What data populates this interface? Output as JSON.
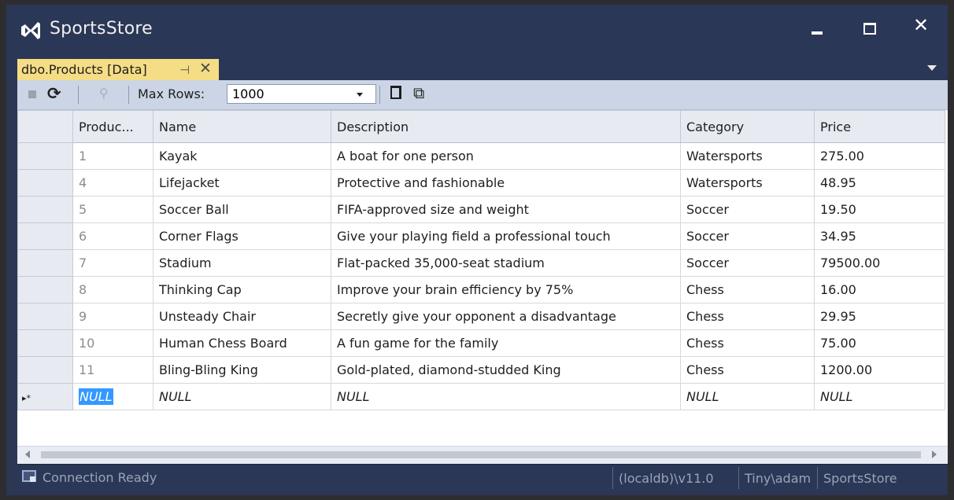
{
  "window": {
    "title": "SportsStore",
    "minimize_glyph": "minimize",
    "maximize_glyph": "maximize",
    "close_glyph": "✕"
  },
  "tab": {
    "label": "dbo.Products [Data]",
    "pin_glyph": "⊣",
    "close_glyph": "✕"
  },
  "toolbar": {
    "max_rows_label": "Max Rows:",
    "max_rows_value": "1000"
  },
  "grid": {
    "columns": [
      "Produc...",
      "Name",
      "Description",
      "Category",
      "Price"
    ],
    "rows": [
      {
        "id": "1",
        "name": "Kayak",
        "description": "A boat for one person",
        "category": "Watersports",
        "price": "275.00"
      },
      {
        "id": "4",
        "name": "Lifejacket",
        "description": "Protective and fashionable",
        "category": "Watersports",
        "price": "48.95"
      },
      {
        "id": "5",
        "name": "Soccer Ball",
        "description": "FIFA-approved size and weight",
        "category": "Soccer",
        "price": "19.50"
      },
      {
        "id": "6",
        "name": "Corner Flags",
        "description": "Give your playing field a professional touch",
        "category": "Soccer",
        "price": "34.95"
      },
      {
        "id": "7",
        "name": "Stadium",
        "description": "Flat-packed 35,000-seat stadium",
        "category": "Soccer",
        "price": "79500.00"
      },
      {
        "id": "8",
        "name": "Thinking Cap",
        "description": "Improve your brain efficiency by 75%",
        "category": "Chess",
        "price": "16.00"
      },
      {
        "id": "9",
        "name": "Unsteady Chair",
        "description": "Secretly give your opponent a disadvantage",
        "category": "Chess",
        "price": "29.95"
      },
      {
        "id": "10",
        "name": "Human Chess Board",
        "description": "A fun game for the family",
        "category": "Chess",
        "price": "75.00"
      },
      {
        "id": "11",
        "name": "Bling-Bling King",
        "description": "Gold-plated, diamond-studded King",
        "category": "Chess",
        "price": "1200.00"
      }
    ],
    "new_row": {
      "marker": "▸*",
      "id": "NULL",
      "name": "NULL",
      "description": "NULL",
      "category": "NULL",
      "price": "NULL"
    }
  },
  "statusbar": {
    "status": "Connection Ready",
    "server": "(localdb)\\v11.0",
    "user": "Tiny\\adam",
    "database": "SportsStore"
  },
  "colors": {
    "chrome": "#2b3756",
    "tab_active": "#f5dd85",
    "toolbar": "#ccd5e6",
    "selection": "#3399ff"
  }
}
